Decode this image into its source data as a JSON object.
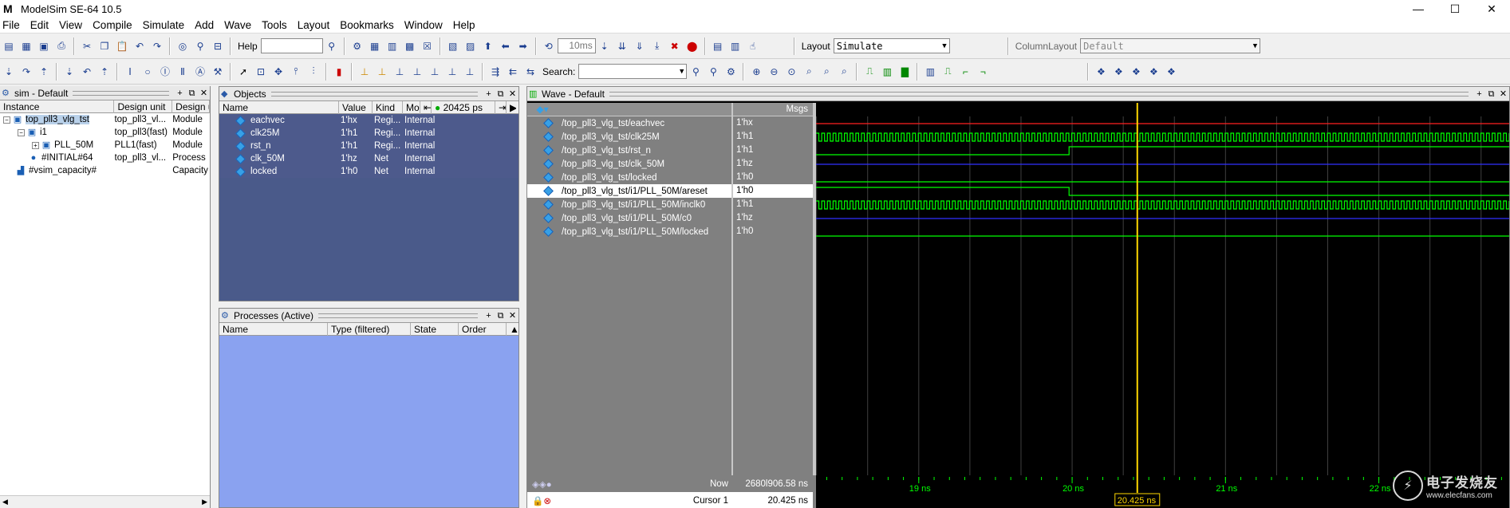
{
  "window": {
    "title": "ModelSim SE-64 10.5",
    "app_letter": "M",
    "minimize": "—",
    "maximize": "☐",
    "close": "✕"
  },
  "menu": [
    "File",
    "Edit",
    "View",
    "Compile",
    "Simulate",
    "Add",
    "Wave",
    "Tools",
    "Layout",
    "Bookmarks",
    "Window",
    "Help"
  ],
  "toolbar": {
    "help_label": "Help",
    "run_length": "10ms",
    "layout_label": "Layout",
    "layout_value": "Simulate",
    "column_layout_label": "ColumnLayout",
    "column_layout_value": "Default",
    "search_label": "Search:"
  },
  "sim_panel": {
    "title": "sim - Default",
    "columns": [
      "Instance",
      "Design unit",
      "Design ur"
    ],
    "rows": [
      {
        "instance": "top_pll3_vlg_tst",
        "unit": "top_pll3_vl...",
        "type": "Module",
        "indent": 0,
        "expander": "−"
      },
      {
        "instance": "i1",
        "unit": "top_pll3(fast)",
        "type": "Module",
        "indent": 1,
        "expander": "−"
      },
      {
        "instance": "PLL_50M",
        "unit": "PLL1(fast)",
        "type": "Module",
        "indent": 2,
        "expander": "+"
      },
      {
        "instance": "#INITIAL#64",
        "unit": "top_pll3_vl...",
        "type": "Process",
        "indent": 1,
        "expander": ""
      },
      {
        "instance": "#vsim_capacity#",
        "unit": "",
        "type": "Capacity",
        "indent": 0,
        "expander": ""
      }
    ],
    "scroll_left": "◀",
    "scroll_right": "▶"
  },
  "objects_panel": {
    "title": "Objects",
    "columns": [
      "Name",
      "Value",
      "Kind",
      "Mod"
    ],
    "time": "20425 ps",
    "rows": [
      {
        "name": "eachvec",
        "value": "1'hx",
        "kind": "Regi...",
        "mode": "Internal"
      },
      {
        "name": "clk25M",
        "value": "1'h1",
        "kind": "Regi...",
        "mode": "Internal"
      },
      {
        "name": "rst_n",
        "value": "1'h1",
        "kind": "Regi...",
        "mode": "Internal"
      },
      {
        "name": "clk_50M",
        "value": "1'hz",
        "kind": "Net",
        "mode": "Internal"
      },
      {
        "name": "locked",
        "value": "1'h0",
        "kind": "Net",
        "mode": "Internal"
      }
    ]
  },
  "processes_panel": {
    "title": "Processes (Active)",
    "columns": [
      "Name",
      "Type (filtered)",
      "State",
      "Order"
    ]
  },
  "wave_panel": {
    "title": "Wave - Default",
    "msgs_label": "Msgs",
    "signals": [
      {
        "path": "/top_pll3_vlg_tst/eachvec",
        "value": "1'hx"
      },
      {
        "path": "/top_pll3_vlg_tst/clk25M",
        "value": "1'h1"
      },
      {
        "path": "/top_pll3_vlg_tst/rst_n",
        "value": "1'h1"
      },
      {
        "path": "/top_pll3_vlg_tst/clk_50M",
        "value": "1'hz"
      },
      {
        "path": "/top_pll3_vlg_tst/locked",
        "value": "1'h0"
      },
      {
        "path": "/top_pll3_vlg_tst/i1/PLL_50M/areset",
        "value": "1'h0"
      },
      {
        "path": "/top_pll3_vlg_tst/i1/PLL_50M/inclk0",
        "value": "1'h1"
      },
      {
        "path": "/top_pll3_vlg_tst/i1/PLL_50M/c0",
        "value": "1'hz"
      },
      {
        "path": "/top_pll3_vlg_tst/i1/PLL_50M/locked",
        "value": "1'h0"
      }
    ],
    "selected_index": 5,
    "now_label": "Now",
    "now_value": "2680l906.58 ns",
    "cursor_label": "Cursor 1",
    "cursor_value": "20.425 ns",
    "cursor_time_ns": 20.425,
    "cursor_tag": "20.425 ns",
    "timeline_labels": [
      {
        "t": 19,
        "text": "19 ns"
      },
      {
        "t": 20,
        "text": "20 ns"
      },
      {
        "t": 21,
        "text": "21 ns"
      },
      {
        "t": 22,
        "text": "22 ns"
      }
    ],
    "time_start_ns": 18.33,
    "time_end_ns": 22.85,
    "rst_rise_ns": 19.98,
    "colors": {
      "wave": "#00ff00",
      "red": "#ff2020",
      "blue": "#3030ff",
      "cursor": "#ffd700",
      "grid": "#404040"
    }
  },
  "watermark": {
    "cn": "电子发烧友",
    "url": "www.elecfans.com"
  }
}
